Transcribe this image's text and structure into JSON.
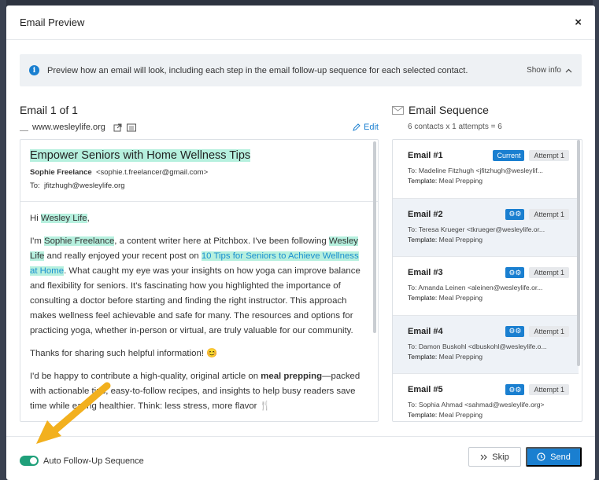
{
  "modal": {
    "title": "Email Preview",
    "close": "×"
  },
  "info_bar": {
    "text": "Preview how an email will look, including each step in the email follow-up sequence for each selected contact.",
    "toggle": "Show info"
  },
  "preview": {
    "count": "Email 1 of 1",
    "site": "www.wesleylife.org",
    "edit": "Edit",
    "subject": "Empower Seniors with Home Wellness Tips",
    "from_name": "Sophie Freelance",
    "from_email": "<sophie.t.freelancer@gmail.com>",
    "to_label": "To:",
    "to_email": "jfitzhugh@wesleylife.org",
    "greeting_pre": "Hi ",
    "greeting_org": "Wesley Life",
    "greeting_post": ",",
    "p1_a": "I'm ",
    "p1_name": "Sophie Freelance",
    "p1_b": ", a content writer here at Pitchbox. I've been following ",
    "p1_org": "Wesley Life",
    "p1_c": " and really enjoyed your recent post on ",
    "p1_link": "10 Tips for Seniors to Achieve Wellness at Home",
    "p1_d": ". What caught my eye was your insights on how yoga can improve balance and flexibility for seniors. It's fascinating how you highlighted the importance of consulting a doctor before starting and finding the right instructor. This approach makes wellness feel achievable and safe for many. The resources and options for practicing yoga, whether in-person or virtual, are truly valuable for our community.",
    "p2": "Thanks for sharing such helpful information! 😊",
    "p3_a": "I'd be happy to contribute a high-quality, original article on ",
    "p3_bold": "meal prepping",
    "p3_b": "—packed with actionable tips, easy-to-follow recipes, and insights to help busy readers save time while eating healthier. Think: less stress, more flavor 🍴"
  },
  "sequence": {
    "title": "Email Sequence",
    "subtitle": "6 contacts x 1 attempts = 6",
    "items": [
      {
        "name": "Email #1",
        "badge": "Current",
        "attempt": "Attempt 1",
        "to": "To: Madeline Fitzhugh <jfitzhugh@wesleylif...",
        "template_label": "Template:",
        "template": "Meal Prepping"
      },
      {
        "name": "Email #2",
        "badge": "",
        "attempt": "Attempt 1",
        "to": "To: Teresa Krueger <tkrueger@wesleylife.or...",
        "template_label": "Template:",
        "template": "Meal Prepping"
      },
      {
        "name": "Email #3",
        "badge": "",
        "attempt": "Attempt 1",
        "to": "To: Amanda Leinen <aleinen@wesleylife.or...",
        "template_label": "Template:",
        "template": "Meal Prepping"
      },
      {
        "name": "Email #4",
        "badge": "",
        "attempt": "Attempt 1",
        "to": "To: Damon Buskohl <dbuskohl@wesleylife.o...",
        "template_label": "Template:",
        "template": "Meal Prepping"
      },
      {
        "name": "Email #5",
        "badge": "",
        "attempt": "Attempt 1",
        "to": "To: Sophia Ahmad <sahmad@wesleylife.org>",
        "template_label": "Template:",
        "template": "Meal Prepping"
      }
    ]
  },
  "footer": {
    "toggle_label": "Auto Follow-Up Sequence",
    "skip": "Skip",
    "send": "Send"
  },
  "colors": {
    "accent": "#1a7fd0",
    "toggle_on": "#1fa07a",
    "highlight": "#b6f0de",
    "arrow": "#f2b01e"
  }
}
